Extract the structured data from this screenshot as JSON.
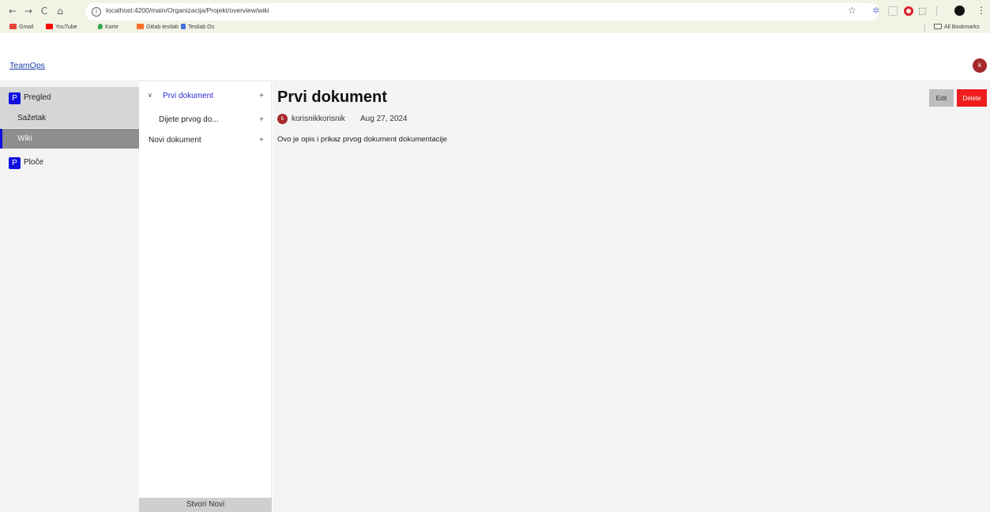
{
  "browser": {
    "url": "localhost:4200/main/Organizacija/Projekt/overview/wiki",
    "bookmarks": [
      {
        "label": "Gmail",
        "color": "#ea4335"
      },
      {
        "label": "YouTube",
        "color": "#ff0000"
      },
      {
        "label": "Karte",
        "color": "#34a853"
      },
      {
        "label": "Gitlab testlab",
        "color": "#fc6d26"
      },
      {
        "label": "Testlab Os",
        "color": "#4a6fe3"
      }
    ],
    "all_bookmarks": "All Bookmarks",
    "icons": {
      "back": "←",
      "forward": "→",
      "reload": "C",
      "home": "⌂",
      "star": "☆",
      "ext1": "✲",
      "ext4": "⬚",
      "menu": "⋮"
    }
  },
  "header": {
    "brand": "TeamOps",
    "avatar_initial": "k"
  },
  "left_nav": {
    "pregled": {
      "badge": "P",
      "label": "Pregled"
    },
    "sazetak": "Sažetak",
    "wiki": "Wiki",
    "ploce": {
      "badge": "P",
      "label": "Ploče"
    }
  },
  "doc_tree": {
    "items": [
      {
        "label": "Prvi dokument",
        "chevron": "∨",
        "plus": "+"
      },
      {
        "label": "Dijete prvog do...",
        "plus": "+"
      },
      {
        "label": "Novi dokument",
        "plus": "+"
      }
    ],
    "create_button": "Stvori Novi"
  },
  "document": {
    "title": "Prvi dokument",
    "author_initial": "k",
    "author": "korisnikkorisnik",
    "date": "Aug 27, 2024",
    "description": "Ovo je opis i prikaz prvog dokument dokumentacije",
    "edit_label": "Edit",
    "delete_label": "Delete"
  },
  "colors": {
    "accent": "#1010e0",
    "danger": "#ee1c1c",
    "avatar": "#a7282b"
  }
}
